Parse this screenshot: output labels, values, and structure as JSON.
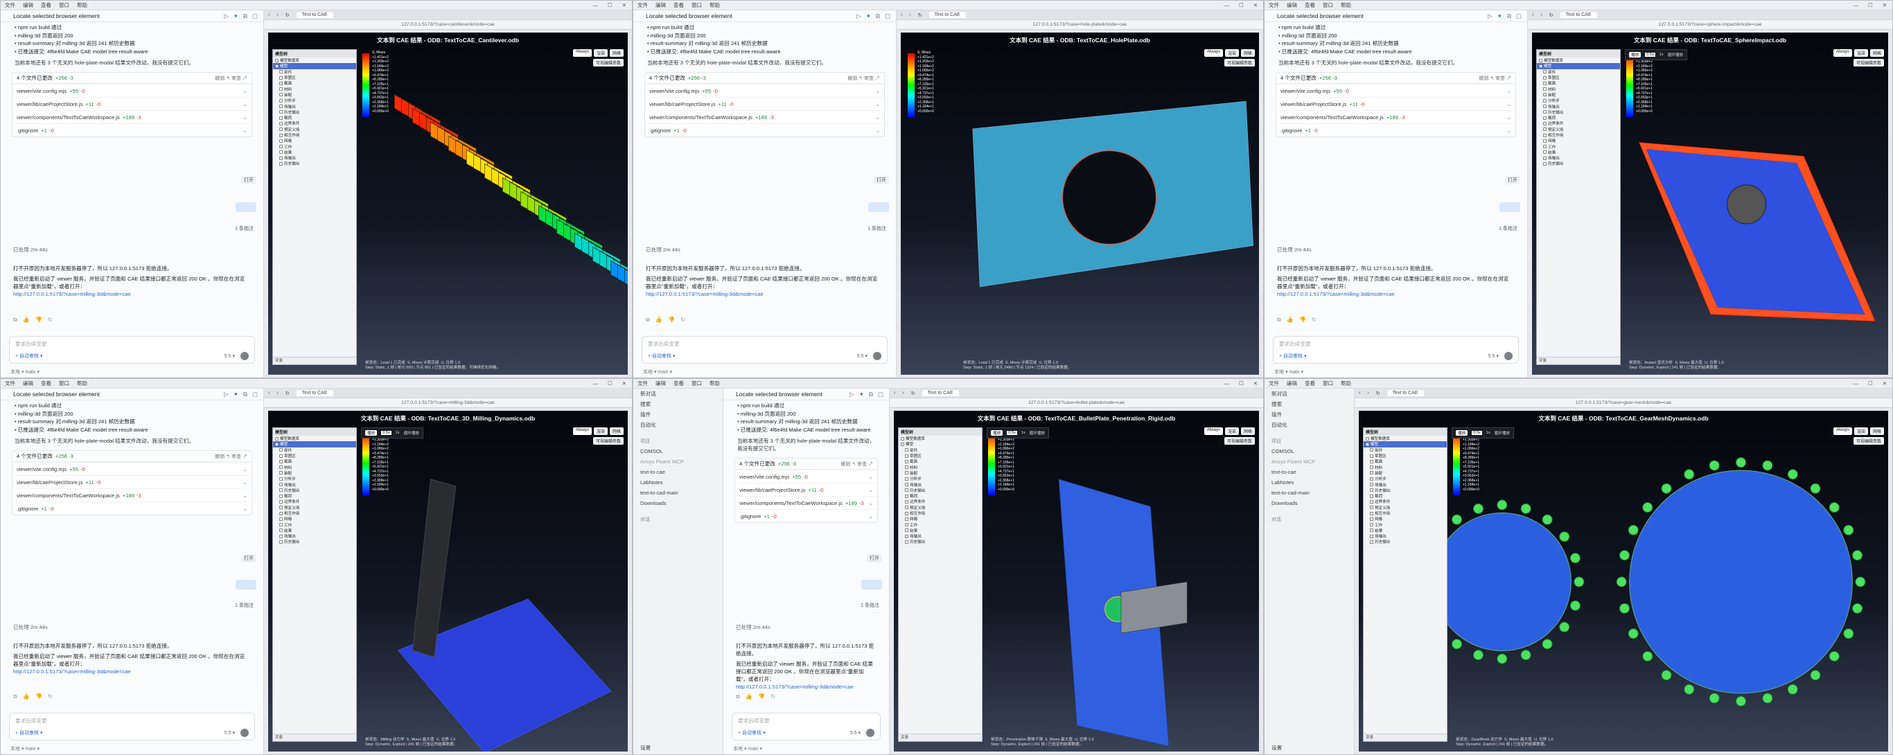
{
  "menubar": {
    "items": [
      "文件",
      "编辑",
      "查看",
      "窗口",
      "帮助"
    ],
    "window_controls": [
      "—",
      "☐",
      "✕"
    ]
  },
  "sidebar": {
    "items": [
      "新对话",
      "搜索",
      "插件",
      "自动化"
    ],
    "section": "项目",
    "projects": [
      "COMSOL",
      "Ansys Fluent MCP",
      "text-to-cae",
      "LabNotes",
      "text-to-cad-main",
      "Downloads"
    ],
    "section2": "对话",
    "recent": "最近对话",
    "settings": "设置"
  },
  "chat": {
    "title": "Locate selected browser element",
    "bullets": [
      "npm run build 通过",
      "milling-3d 页面返回 200",
      "result-summary 对 milling-3d 返回 241 帧历史数据",
      "已推送提交: 4f6e4fd Make CAE model tree result-aware"
    ],
    "note": "当前本地还有 3 个无关的 hole-plate-modal 结果文件改动，我没有提交它们。",
    "files_header": "4 个文件已更改",
    "files_header_stat": "+256 -3",
    "files_actions": "撤销 ↰  审查 ↗",
    "files": [
      {
        "name": "viewer/vite.config.mjs",
        "add": "+55",
        "del": "-0"
      },
      {
        "name": "viewer/lib/caeProjectStore.js",
        "add": "+11",
        "del": "-0"
      },
      {
        "name": "viewer/components/TextToCaeWorkspace.js",
        "add": "+189",
        "del": "-3"
      },
      {
        "name": ".gitignore",
        "add": "+1",
        "del": "-0"
      }
    ],
    "expand_label": "打开",
    "steps_label": "1 条指注",
    "done": "已处理 2m 44s",
    "reply1": "打不开原因为本地开发服务器停了，所以 127.0.0.1:5173 拒绝连接。",
    "reply2": "我已经重新启动了 viewer 服务，并验证了页面和 CAE 结果接口都正常返回 200 OK 。你现在在浏览器里点\"重新加载\"，或者打开：",
    "link": "http://127.0.0.1:5173/?case=milling-3d&mode=cae",
    "actions": "⧉ 👍 👎 ↻",
    "input_placeholder": "要求后续变更",
    "input_tool": "+  自动审核 ▾",
    "input_model": "5.5 ▾",
    "footer": "本地 ▾   main ▾"
  },
  "browser": {
    "tab_label": "Text to CAE",
    "configure": "可视编辑参数",
    "btns": [
      "Always",
      "渲染",
      "网格"
    ],
    "play": {
      "btn": "播放",
      "speed": "0.5x",
      "x1": "1x",
      "loop": "循环播放"
    },
    "tree_header": "模型树",
    "tree_rows": [
      "模型数据库",
      "模型",
      "部件",
      "草图区",
      "截面",
      "材料",
      "装配",
      "分析步",
      "场输出",
      "历史输出",
      "载荷",
      "边界条件",
      "预定义场",
      "相互作用",
      "网格",
      "工作",
      "结果",
      "场输出",
      "历史输出"
    ],
    "legend_vals": "S, Mises\n+1.421e+2\n+1.303e+2\n+1.184e+2\n+1.066e+2\n+9.474e+1\n+8.289e+1\n+7.105e+1\n+5.921e+1\n+4.737e+1\n+3.553e+1\n+2.368e+1\n+1.184e+1\n+0.000e+0",
    "tree_bottom": "变量"
  },
  "panels": [
    {
      "layout": "chat",
      "url": "127.0.0.1:5173/?case=cantilever&mode=cae",
      "vtitle": "文本到 CAE 结果 - ODB: TextToCAE_Cantilever.odb",
      "stat": "帧状态：Load 1 已完成  S, Mises 计算完成  U, 位移 1.0\nStep: Static, 1 帧 | 单元 600 | 节点 861 | 已验证的结果数据，可继续优化网格。",
      "play": false,
      "tree_sel": 1
    },
    {
      "layout": "chat",
      "url": "127.0.0.1:5173/?case=hole-plate&mode=cae",
      "vtitle": "文本到 CAE 结果 - ODB: TextToCAE_HolePlate.odb",
      "stat": "帧状态：Load 1 已完成  S, Mises 计算完成  U, 位移 1.0\nStep: Static, 1 帧 | 单元 2480 | 节点 1324 | 已验证的结果数据。",
      "play": false,
      "tree_sel": -1
    },
    {
      "layout": "chat",
      "url": "127.0.0.1:5173/?case=sphere-impact&mode=cae",
      "vtitle": "文本到 CAE 结果 - ODB: TextToCAE_SphereImpact.odb",
      "stat": "帧状态：Impact 显式分析  S, Mises 最大值  U, 位移 1.0\nStep: Dynamic, Explicit | 241 帧 | 已验证的结果数据。",
      "play": true,
      "tree_sel": 1
    },
    {
      "layout": "chat",
      "url": "127.0.0.1:5173/?case=milling-3d&mode=cae",
      "vtitle": "文本到 CAE 结果 - ODB: TextToCAE_3D_Milling_Dynamics.odb",
      "stat": "帧状态：Milling 动力学  S, Mises 最大值  U, 位移 1.0\nStep: Dynamic, Explicit | 241 帧 | 已验证的结果数据。",
      "play": true,
      "tree_sel": 1
    },
    {
      "layout": "side",
      "url": "127.0.0.1:5173/?case=bullet-plate&mode=cae",
      "vtitle": "文本到 CAE 结果 - ODB: TextToCAE_BulletPlate_Penetration_Rigid.odb",
      "stat": "帧状态：Penetration 刚体子弹  S, Mises 最大值  U, 位移 1.0\nStep: Dynamic, Explicit | 241 帧 | 已验证的结果数据。",
      "play": true,
      "tree_sel": -1
    },
    {
      "layout": "side2",
      "url": "127.0.0.1:5173/?case=gear-mesh&mode=cae",
      "vtitle": "文本到 CAE 结果 - ODB: TextToCAE_GearMeshDynamics.odb",
      "stat": "帧状态：GearMesh 动力学  S, Mises 最大值  U, 位移 1.0\nStep: Dynamic, Explicit | 241 帧 | 已验证的结果数据。",
      "play": true,
      "tree_sel": 1
    }
  ]
}
